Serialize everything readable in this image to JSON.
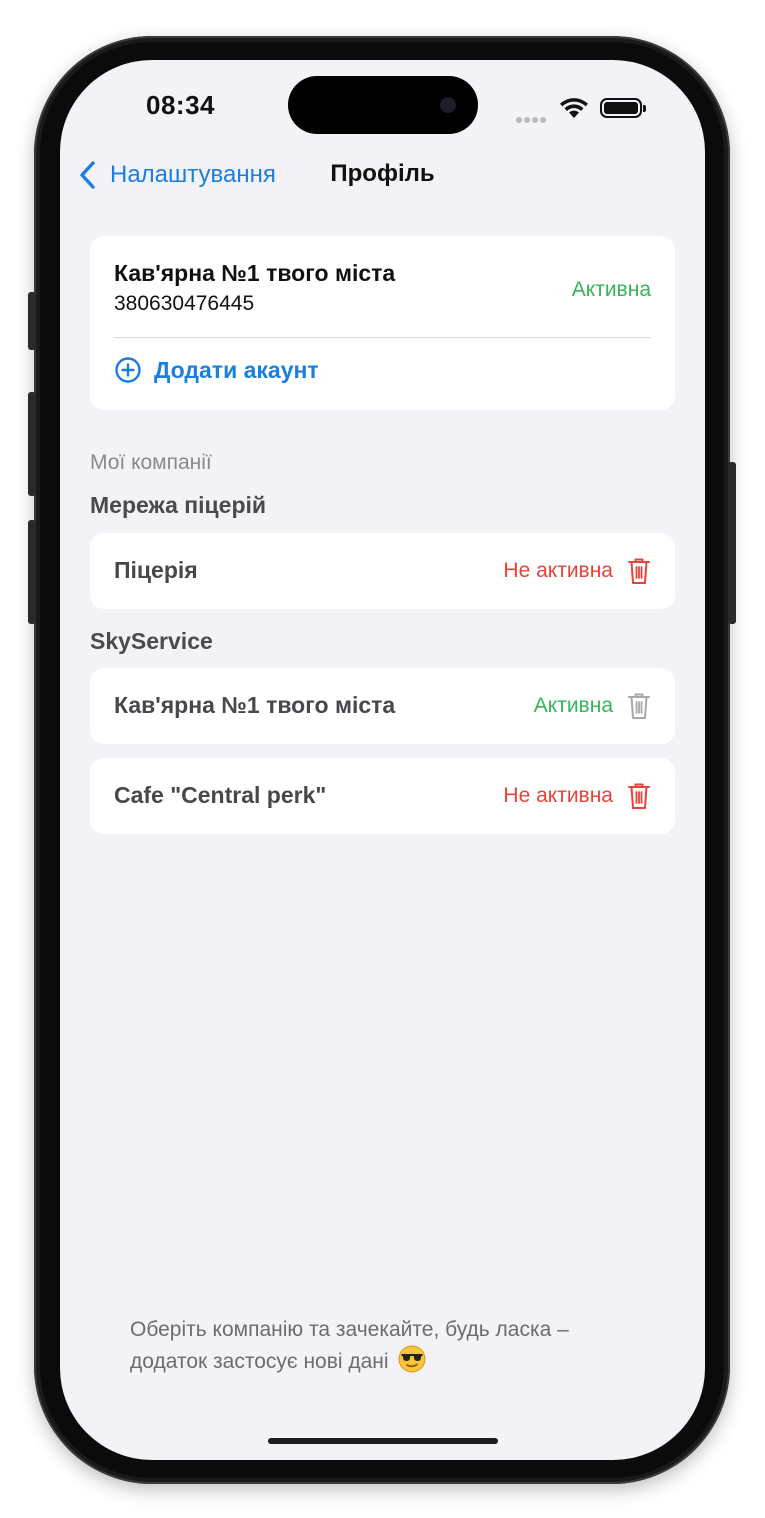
{
  "status_bar": {
    "time": "08:34"
  },
  "nav": {
    "back_label": "Налаштування",
    "title": "Профіль"
  },
  "account": {
    "name": "Кав'ярна №1 твого міста",
    "phone": "380630476445",
    "status": "Активна",
    "add_label": "Додати акаунт"
  },
  "companies": {
    "caption": "Мої компанії",
    "groups": [
      {
        "title": "Мережа піцерій",
        "items": [
          {
            "name": "Піцерія",
            "status": "Не активна"
          }
        ]
      },
      {
        "title": "SkyService",
        "items": [
          {
            "name": "Кав'ярна №1 твого міста",
            "status": "Активна"
          },
          {
            "name": "Cafe \"Central perk\"",
            "status": "Не активна"
          }
        ]
      }
    ]
  },
  "footer": {
    "line1": "Оберіть компанію та зачекайте, будь ласка –",
    "line2": "додаток застосує нові дані"
  },
  "colors": {
    "accent": "#1a7fe0",
    "active": "#34b55a",
    "inactive": "#e8433a",
    "background": "#f2f2f7"
  },
  "icons": [
    "chevron-left-icon",
    "plus-circle-icon",
    "trash-icon",
    "wifi-icon",
    "battery-icon",
    "signal-icon",
    "sunglasses-emoji"
  ]
}
